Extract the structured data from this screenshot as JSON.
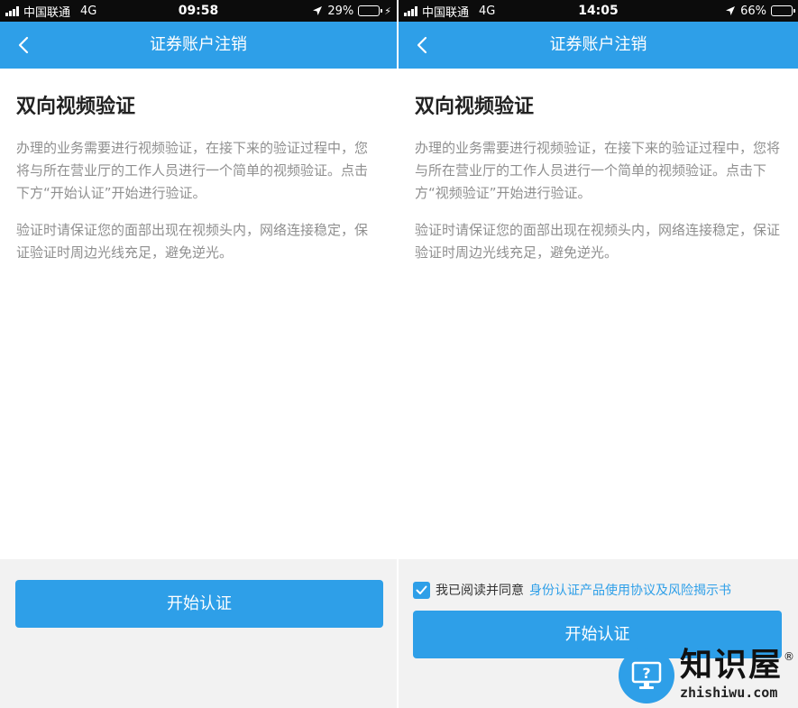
{
  "colors": {
    "accent": "#2e9fe8",
    "status_bar": "#0c0c0c",
    "battery_charging": "#4cd964",
    "muted_text": "#8f8f8f"
  },
  "left": {
    "status": {
      "carrier": "中国联通",
      "network": "4G",
      "time": "09:58",
      "battery_pct": "29%",
      "battery_level": 0.29
    },
    "nav_title": "证券账户注销",
    "heading": "双向视频验证",
    "para1": "办理的业务需要进行视频验证，在接下来的验证过程中，您将与所在营业厅的工作人员进行一个简单的视频验证。点击下方“开始认证”开始进行验证。",
    "para2": "验证时请保证您的面部出现在视频头内，网络连接稳定，保证验证时周边光线充足，避免逆光。",
    "button_label": "开始认证"
  },
  "right": {
    "status": {
      "carrier": "中国联通",
      "network": "4G",
      "time": "14:05",
      "battery_pct": "66%",
      "battery_level": 0.66
    },
    "nav_title": "证券账户注销",
    "heading": "双向视频验证",
    "para1": "办理的业务需要进行视频验证，在接下来的验证过程中，您将与所在营业厅的工作人员进行一个简单的视频验证。点击下方“视频验证”开始进行验证。",
    "para2": "验证时请保证您的面部出现在视频头内，网络连接稳定，保证验证时周边光线充足，避免逆光。",
    "agree_text": "我已阅读并同意",
    "agree_link": "身份认证产品使用协议及风险揭示书",
    "agree_checked": true,
    "button_label": "开始认证"
  },
  "watermark": {
    "name": "知识屋",
    "registered": "®",
    "url": "zhishiwu.com"
  }
}
